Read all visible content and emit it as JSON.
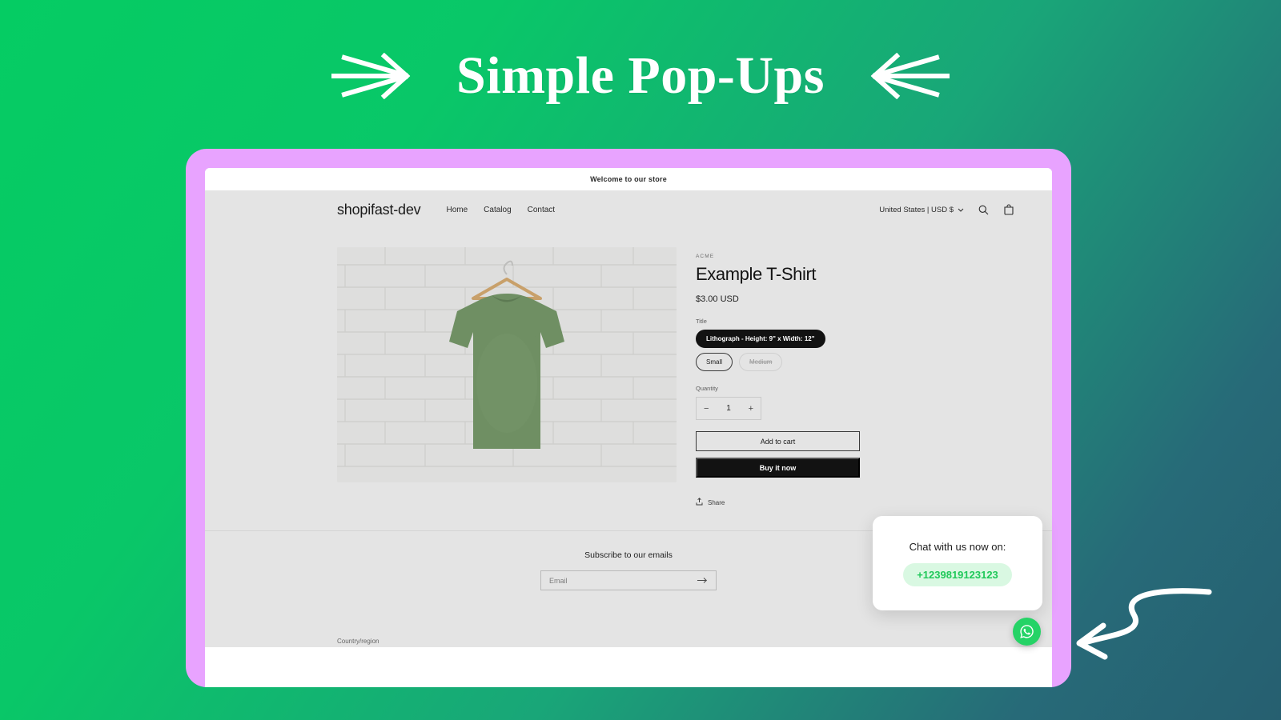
{
  "headline": {
    "text": "Simple Pop-Ups",
    "left_arrow_icon": "arrow-right-icon",
    "right_arrow_icon": "arrow-left-icon"
  },
  "colors": {
    "bg_gradient_start": "#05cc63",
    "bg_gradient_end": "#265f70",
    "browser_frame": "#e8a3ff",
    "whatsapp_green": "#25d366",
    "number_green": "#20c95a",
    "number_pill_bg": "#d9f8e2",
    "page_bg": "#e4e4e4"
  },
  "store": {
    "announcement": "Welcome to our store",
    "logo": "shopifast-dev",
    "nav": [
      {
        "label": "Home"
      },
      {
        "label": "Catalog"
      },
      {
        "label": "Contact"
      }
    ],
    "locale": "United States | USD $",
    "locale_chevron_icon": "chevron-down-icon",
    "search_icon": "search-icon",
    "cart_icon": "cart-icon"
  },
  "product": {
    "vendor": "ACME",
    "title": "Example T-Shirt",
    "price": "$3.00 USD",
    "image_alt": "green t-shirt on wooden hanger against white brick wall",
    "option_label": "Title",
    "variants": [
      {
        "label": "Lithograph - Height: 9\" x Width: 12\"",
        "state": "selected"
      },
      {
        "label": "Small",
        "state": "available"
      },
      {
        "label": "Medium",
        "state": "unavailable"
      }
    ],
    "quantity_label": "Quantity",
    "quantity_decrease": "−",
    "quantity_value": "1",
    "quantity_increase": "+",
    "add_to_cart_label": "Add to cart",
    "buy_now_label": "Buy it now",
    "share_label": "Share",
    "share_icon": "share-icon"
  },
  "newsletter": {
    "title": "Subscribe to our emails",
    "placeholder": "Email",
    "value": "",
    "submit_icon": "arrow-right-icon"
  },
  "footer": {
    "country_region_label": "Country/region"
  },
  "whatsapp": {
    "popup_title": "Chat with us now on:",
    "phone_number": "+1239819123123",
    "fab_icon": "whatsapp-icon"
  },
  "decoration": {
    "curved_arrow_icon": "curved-arrow-left-icon"
  }
}
